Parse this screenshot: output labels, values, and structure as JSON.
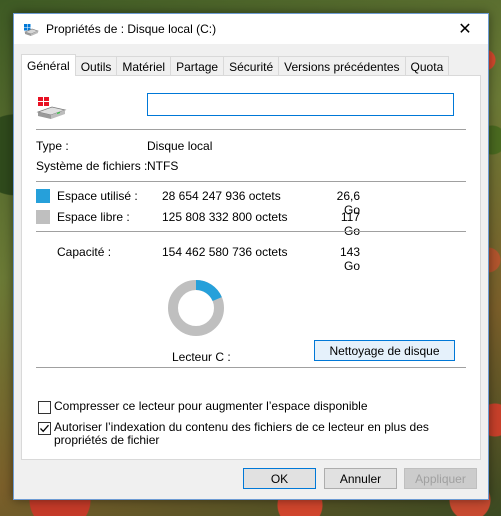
{
  "window": {
    "title": "Propriétés de : Disque local (C:)",
    "close_symbol": "✕"
  },
  "tabs": [
    {
      "label": "Général",
      "active": true
    },
    {
      "label": "Outils"
    },
    {
      "label": "Matériel"
    },
    {
      "label": "Partage"
    },
    {
      "label": "Sécurité"
    },
    {
      "label": "Versions précédentes"
    },
    {
      "label": "Quota"
    }
  ],
  "general": {
    "drive_name_value": "",
    "type_label": "Type :",
    "type_value": "Disque local",
    "fs_label": "Système de fichiers :",
    "fs_value": "NTFS",
    "used": {
      "label": "Espace utilisé :",
      "bytes": "28 654 247 936 octets",
      "size": "26,6 Go",
      "color": "#26a0da"
    },
    "free": {
      "label": "Espace libre :",
      "bytes": "125 808 332 800 octets",
      "size": "117 Go",
      "color": "#bfbfbf"
    },
    "capacity": {
      "label": "Capacité :",
      "bytes": "154 462 580 736 octets",
      "size": "143 Go"
    },
    "used_fraction": 0.186,
    "drive_label": "Lecteur C :",
    "cleanup_button": "Nettoyage de disque",
    "compress_label": "Compresser ce lecteur pour augmenter l’espace disponible",
    "compress_checked": false,
    "index_label": "Autoriser l’indexation du contenu des fichiers de ce lecteur en plus des propriétés de fichier",
    "index_checked": true
  },
  "buttons": {
    "ok": "OK",
    "cancel": "Annuler",
    "apply": "Appliquer"
  },
  "icons": [
    "drive-icon",
    "windows-logo-icon",
    "close-icon",
    "checkmark-icon"
  ]
}
